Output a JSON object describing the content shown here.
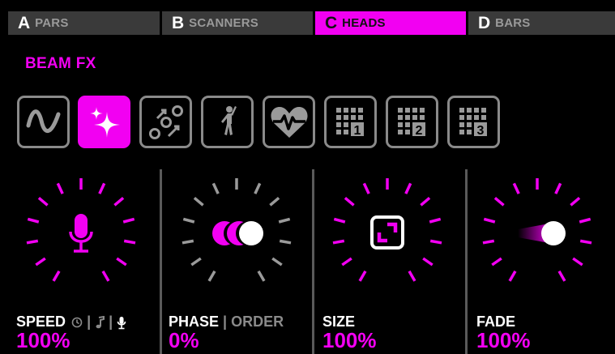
{
  "tabs": [
    {
      "letter": "A",
      "name": "PARS",
      "active": false
    },
    {
      "letter": "B",
      "name": "SCANNERS",
      "active": false
    },
    {
      "letter": "C",
      "name": "HEADS",
      "active": true
    },
    {
      "letter": "D",
      "name": "BARS",
      "active": false
    }
  ],
  "section_title": "BEAM FX",
  "effects": [
    {
      "icon": "sine-wave-icon",
      "active": false
    },
    {
      "icon": "sparkle-icon",
      "active": true
    },
    {
      "icon": "chase-dots-icon",
      "active": false
    },
    {
      "icon": "dancer-icon",
      "active": false
    },
    {
      "icon": "heartbeat-icon",
      "active": false
    },
    {
      "icon": "grid-1-icon",
      "label": "1",
      "active": false
    },
    {
      "icon": "grid-2-icon",
      "label": "2",
      "active": false
    },
    {
      "icon": "grid-3-icon",
      "label": "3",
      "active": false
    }
  ],
  "panels": {
    "speed": {
      "label": "SPEED",
      "sub_sep1": "|",
      "sub_sep2": "|",
      "value": "100%",
      "icon": "microphone-icon",
      "mode_icons": [
        "clock-icon",
        "music-note-icon",
        "microphone-icon"
      ]
    },
    "phase": {
      "label": "PHASE",
      "sep": "|",
      "sub": "ORDER",
      "value": "0%",
      "icon": "phase-circles-icon"
    },
    "size": {
      "label": "SIZE",
      "value": "100%",
      "icon": "expand-icon"
    },
    "fade": {
      "label": "FADE",
      "value": "100%",
      "icon": "fade-dot-icon"
    }
  },
  "colors": {
    "accent": "#f200f2",
    "tab_bg": "#3a3a3a",
    "inactive_tick": "#9a9a9a"
  }
}
